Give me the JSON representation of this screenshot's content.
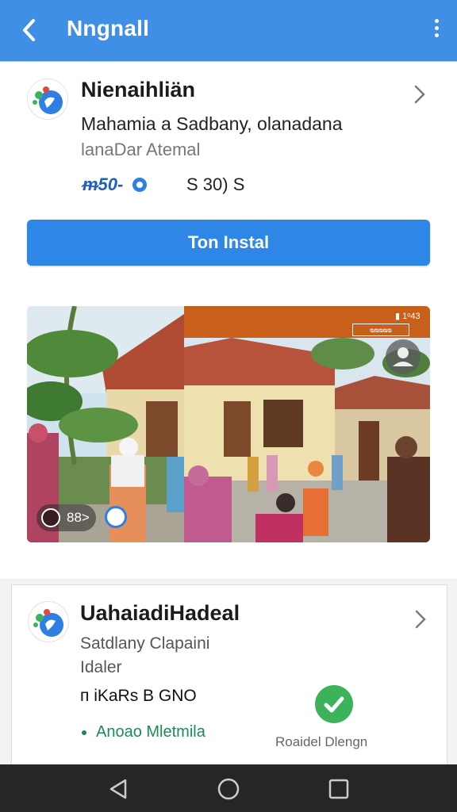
{
  "appbar": {
    "title": "Nngnall",
    "back_icon": "back-arrow-icon",
    "more_icon": "more-vert-icon",
    "color": "#3f8fe6"
  },
  "listing1": {
    "name": "Nienaihliän",
    "developer": "Mahamia a Sadbany, olanadana",
    "category": "lanaDar Atemal",
    "rating": "ᵯ50-",
    "size": "S 30) S",
    "install_label": "Ton Instal"
  },
  "screenshot": {
    "counter": "88>",
    "status_text": "▮ 1ᵒ43",
    "tag": "ᴓᴓᴓᴓᴓ"
  },
  "listing2": {
    "name": "UahaiadiHadeal",
    "developer": "Satdlany Clapaini",
    "category": "Idaler",
    "stats": "ᴨ iKaRs B GNO",
    "tag": "Anoao Mletmila",
    "check_label": "Roaidel Dlengn"
  },
  "colors": {
    "accent": "#2e86e6",
    "nav": "#262626",
    "success": "#3cb35a"
  }
}
